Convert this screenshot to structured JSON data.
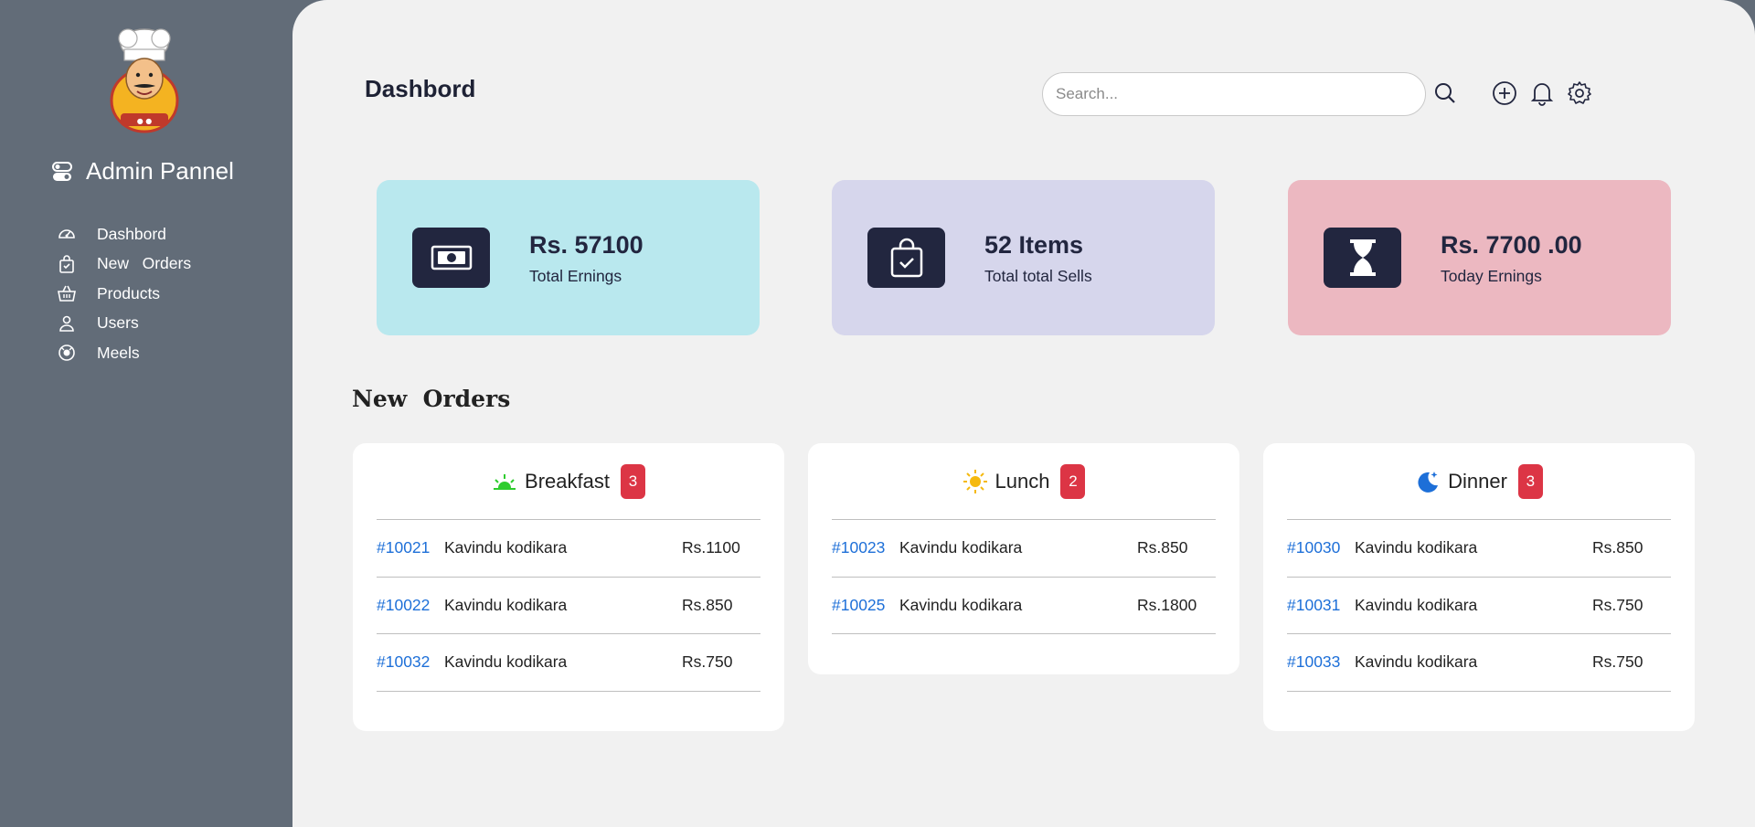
{
  "sidebar": {
    "title": "Admin Pannel",
    "logo_icon": "chef-logo-icon",
    "items": [
      {
        "label": "Dashbord",
        "icon": "gauge-icon"
      },
      {
        "label": "New   Orders",
        "icon": "bag-check-icon"
      },
      {
        "label": "Products",
        "icon": "basket-icon"
      },
      {
        "label": "Users",
        "icon": "user-icon"
      },
      {
        "label": "Meels",
        "icon": "meal-icon"
      }
    ]
  },
  "header": {
    "title": "Dashbord",
    "search_placeholder": "Search...",
    "icons": [
      "search-icon",
      "plus-circle-icon",
      "bell-icon",
      "gear-icon"
    ]
  },
  "stats": [
    {
      "value": "Rs. 57100",
      "caption": "Total Ernings",
      "color": "#b9e8ee",
      "icon": "cash-icon"
    },
    {
      "value": "52 Items",
      "caption": "Total total Sells",
      "color": "#d6d6ec",
      "icon": "bag-check-icon"
    },
    {
      "value": "Rs. 7700 .00",
      "caption": "Today Ernings",
      "color": "#ecb8c1",
      "icon": "hourglass-icon"
    }
  ],
  "orders": {
    "title": "New  Orders",
    "meals": [
      {
        "name": "Breakfast",
        "count": "3",
        "icon": "sunrise-icon",
        "icon_color": "#2ecc2e",
        "rows": [
          {
            "id": "#10021",
            "name": "Kavindu kodikara",
            "price": "Rs.1100"
          },
          {
            "id": "#10022",
            "name": "Kavindu kodikara",
            "price": "Rs.850"
          },
          {
            "id": "#10032",
            "name": "Kavindu kodikara",
            "price": "Rs.750"
          }
        ]
      },
      {
        "name": "Lunch",
        "count": "2",
        "icon": "sun-icon",
        "icon_color": "#f5b90f",
        "rows": [
          {
            "id": "#10023",
            "name": "Kavindu kodikara",
            "price": "Rs.850"
          },
          {
            "id": "#10025",
            "name": "Kavindu kodikara",
            "price": "Rs.1800"
          }
        ]
      },
      {
        "name": "Dinner",
        "count": "3",
        "icon": "moon-stars-icon",
        "icon_color": "#1d6fd8",
        "rows": [
          {
            "id": "#10030",
            "name": "Kavindu kodikara",
            "price": "Rs.850"
          },
          {
            "id": "#10031",
            "name": "Kavindu kodikara",
            "price": "Rs.750"
          },
          {
            "id": "#10033",
            "name": "Kavindu kodikara",
            "price": "Rs.750"
          }
        ]
      }
    ]
  },
  "colors": {
    "sidebar_bg": "#626c78",
    "main_bg": "#f1f1f1",
    "dark": "#22263f",
    "link": "#1d6fd8",
    "badge": "#dc3545"
  }
}
